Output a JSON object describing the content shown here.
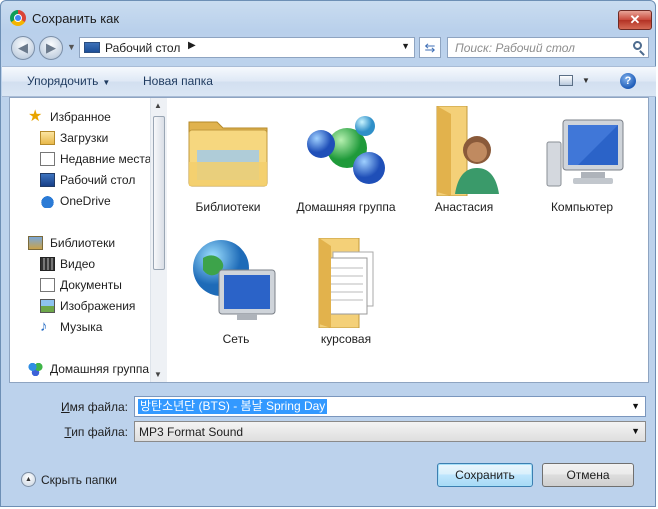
{
  "window": {
    "title": "Сохранить как",
    "close_label": "✕"
  },
  "navbar": {
    "back_icon": "back-arrow-icon",
    "forward_icon": "forward-arrow-icon",
    "address": "Рабочий стол",
    "search_placeholder": "Поиск: Рабочий стол"
  },
  "toolbar": {
    "organize_label": "Упорядочить",
    "new_folder_label": "Новая папка",
    "help_label": "?"
  },
  "nav_pane": {
    "favorites_header": "Избранное",
    "favorites": [
      "Загрузки",
      "Недавние места",
      "Рабочий стол",
      "OneDrive"
    ],
    "libraries_header": "Библиотеки",
    "libraries": [
      "Видео",
      "Документы",
      "Изображения",
      "Музыка"
    ],
    "homegroup": "Домашняя группа"
  },
  "files": [
    {
      "label": "Библиотеки",
      "icon": "libraries-folder-icon"
    },
    {
      "label": "Домашняя группа",
      "icon": "homegroup-icon"
    },
    {
      "label": "Анастасия",
      "icon": "user-folder-icon"
    },
    {
      "label": "Компьютер",
      "icon": "computer-icon"
    },
    {
      "label": "Сеть",
      "icon": "network-icon"
    },
    {
      "label": "курсовая",
      "icon": "documents-folder-icon"
    }
  ],
  "form": {
    "filename_label_u": "И",
    "filename_label_rest": "мя файла:",
    "filename_value": "방탄소년단 (BTS) - 봄날 Spring Day",
    "filetype_label_u": "Т",
    "filetype_label_rest": "ип файла:",
    "filetype_value": "MP3 Format Sound"
  },
  "footer": {
    "hide_folders_label": "Скрыть папки",
    "save_label": "Сохранить",
    "cancel_label": "Отмена"
  }
}
